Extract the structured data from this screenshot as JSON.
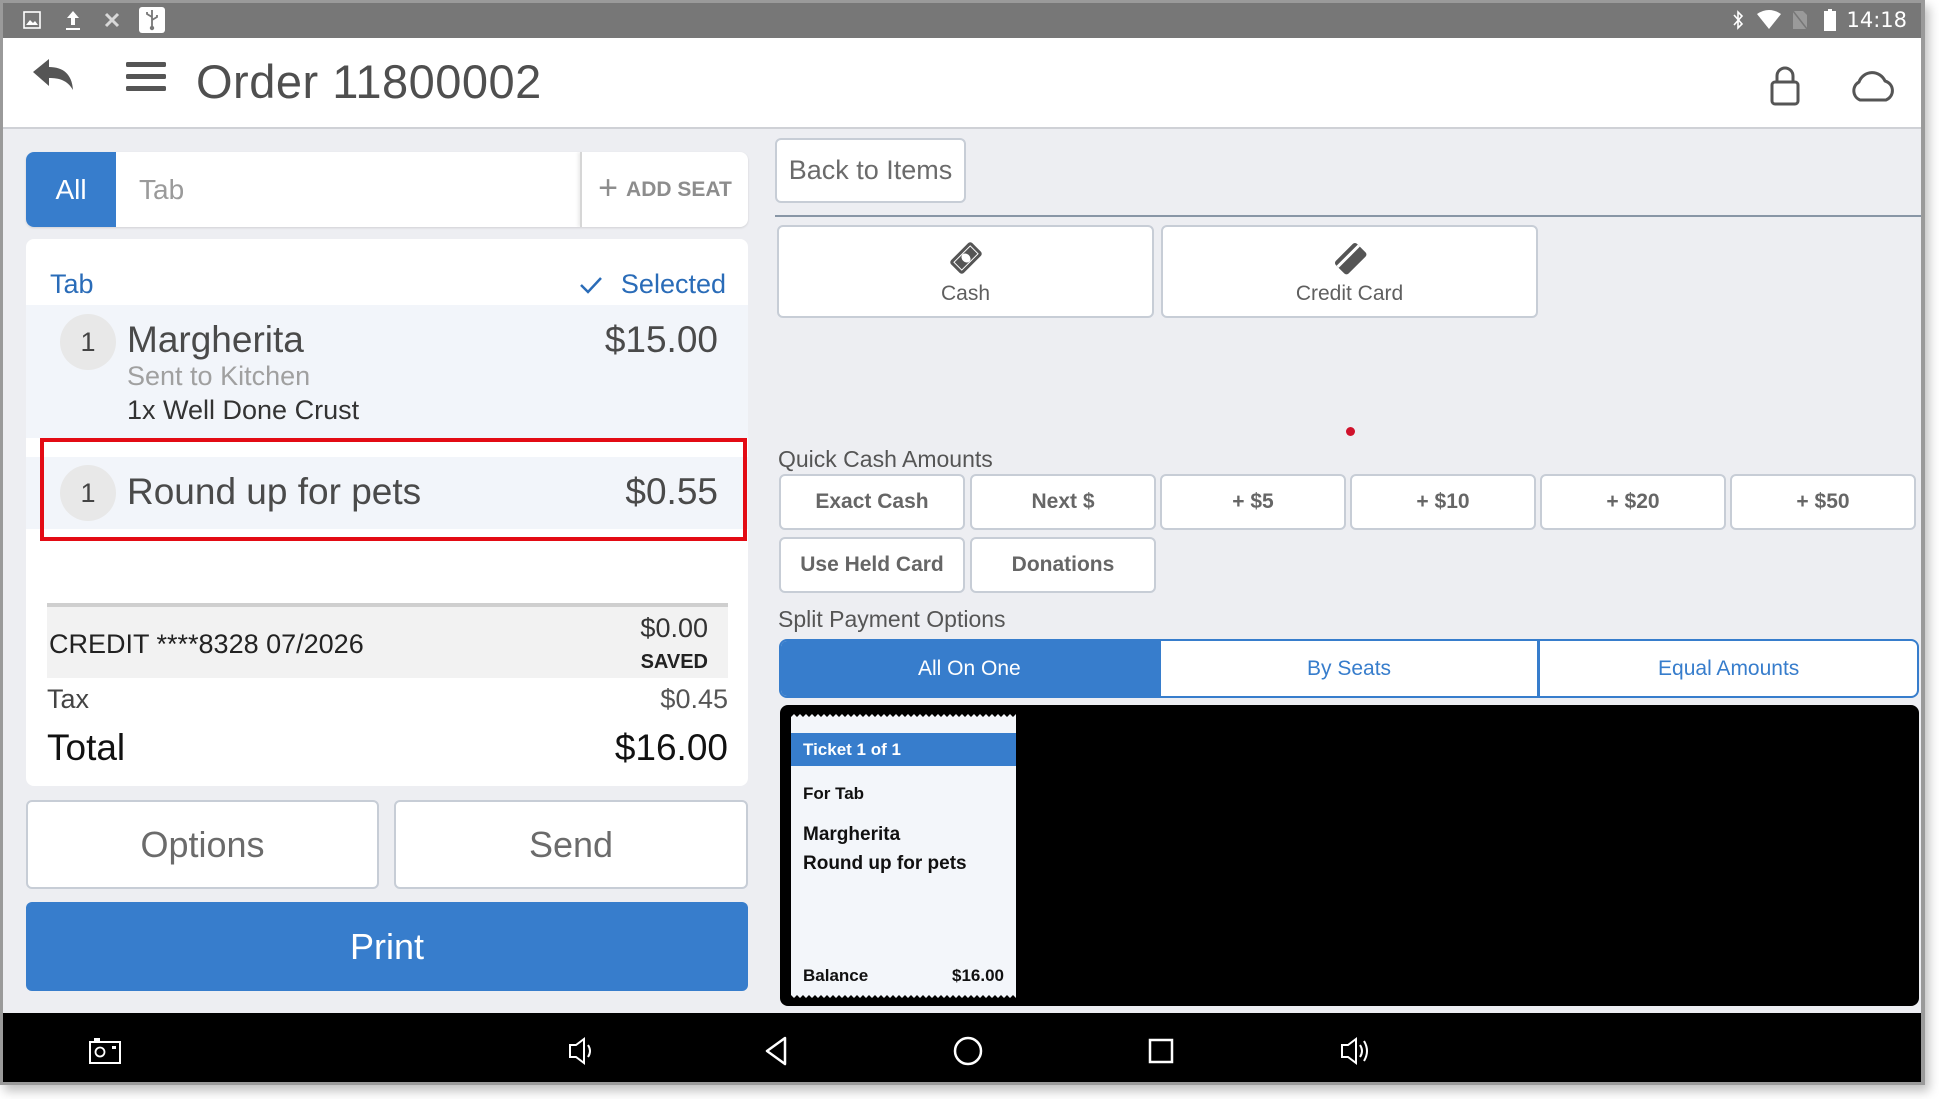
{
  "status_bar": {
    "left_icons": [
      "image-notification-icon",
      "upload-icon",
      "wrench-off-icon",
      "usb-icon"
    ],
    "right_icons": [
      "bluetooth-icon",
      "wifi-icon",
      "no-sim-icon",
      "battery-icon"
    ],
    "time": "14:18"
  },
  "header": {
    "title": "Order 11800002",
    "icons": [
      "back-icon",
      "menu-icon",
      "lock-icon",
      "cloud-icon"
    ]
  },
  "seat_bar": {
    "all_label": "All",
    "tab_label": "Tab",
    "add_seat_label": "ADD SEAT"
  },
  "order": {
    "section_title": "Tab",
    "selected_label": "Selected",
    "items": [
      {
        "qty": "1",
        "name": "Margherita",
        "price": "$15.00",
        "status": "Sent to Kitchen",
        "modifier": "1x  Well Done Crust"
      },
      {
        "qty": "1",
        "name": "Round up for pets",
        "price": "$0.55"
      }
    ],
    "credit": {
      "label": "CREDIT ****8328 07/2026",
      "amount": "$0.00",
      "status": "SAVED"
    },
    "tax_label": "Tax",
    "tax_value": "$0.45",
    "total_label": "Total",
    "total_value": "$16.00"
  },
  "actions": {
    "options_label": "Options",
    "send_label": "Send",
    "print_label": "Print"
  },
  "payment": {
    "back_label": "Back to Items",
    "methods": [
      {
        "label": "Cash",
        "icon": "cash-icon"
      },
      {
        "label": "Credit Card",
        "icon": "credit-card-icon"
      }
    ],
    "quick_cash_title": "Quick Cash Amounts",
    "quick_cash": [
      "Exact Cash",
      "Next $",
      "+ $5",
      "+ $10",
      "+ $20",
      "+ $50",
      "Use Held Card",
      "Donations"
    ],
    "split_title": "Split Payment Options",
    "split_options": [
      "All On One",
      "By Seats",
      "Equal Amounts"
    ],
    "split_active": "All On One"
  },
  "ticket": {
    "header": "Ticket 1 of 1",
    "for_label": "For Tab",
    "items": [
      "Margherita",
      "Round up for pets"
    ],
    "balance_label": "Balance",
    "balance_value": "$16.00"
  },
  "nav_bar": {
    "icons": [
      "screenshot-icon",
      "volume-down-icon",
      "back-nav-icon",
      "home-icon",
      "recents-icon",
      "volume-up-icon"
    ]
  },
  "colors": {
    "accent": "#377dcc",
    "highlight_box": "#e30b14",
    "link": "#2a6cb8"
  }
}
